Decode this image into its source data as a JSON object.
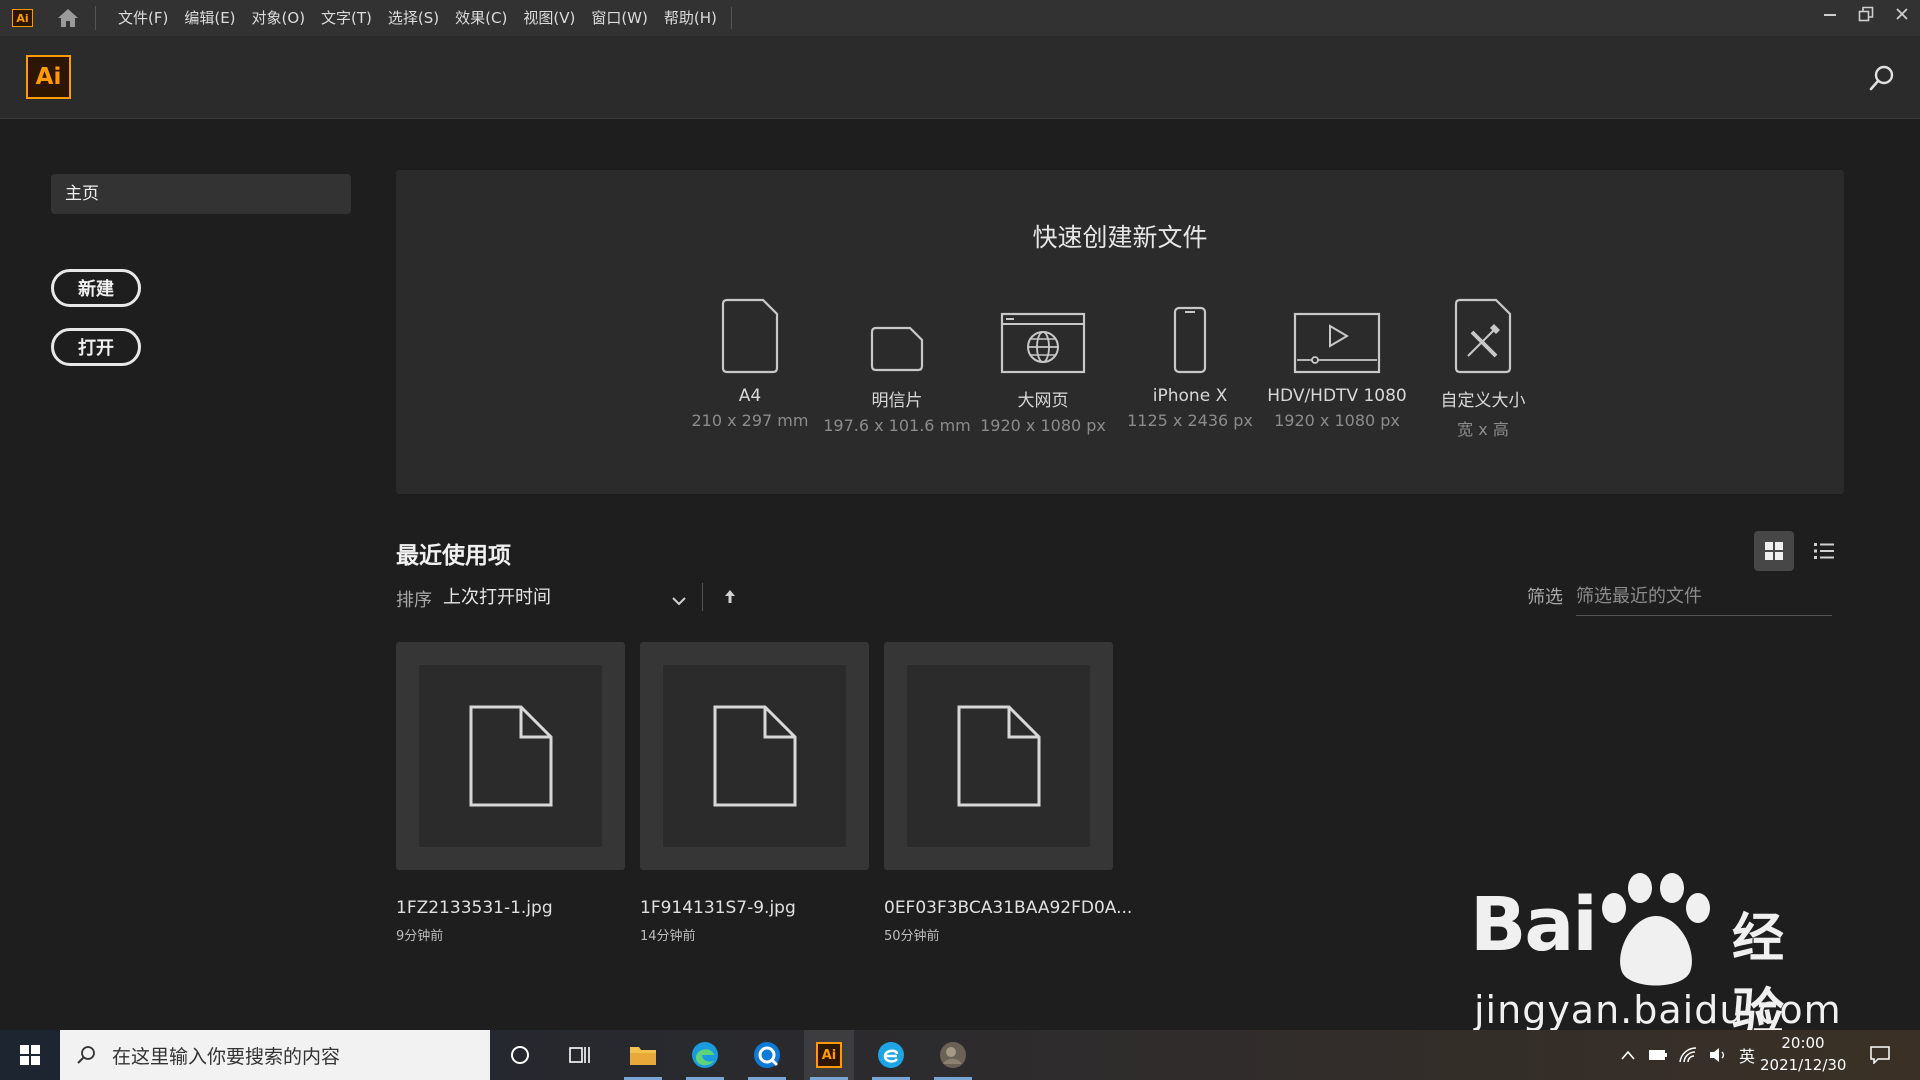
{
  "menubar": {
    "app_badge": "Ai",
    "items": [
      "文件(F)",
      "编辑(E)",
      "对象(O)",
      "文字(T)",
      "选择(S)",
      "效果(C)",
      "视图(V)",
      "窗口(W)",
      "帮助(H)"
    ]
  },
  "header": {
    "logo": "Ai"
  },
  "sidebar": {
    "home": "主页",
    "new_button": "新建",
    "open_button": "打开"
  },
  "quick_create": {
    "title": "快速创建新文件",
    "presets": [
      {
        "name": "A4",
        "dims": "210 x 297 mm",
        "icon": "page-icon"
      },
      {
        "name": "明信片",
        "dims": "197.6 x 101.6 mm",
        "icon": "postcard-icon"
      },
      {
        "name": "大网页",
        "dims": "1920 x 1080 px",
        "icon": "web-icon"
      },
      {
        "name": "iPhone X",
        "dims": "1125 x 2436 px",
        "icon": "phone-icon"
      },
      {
        "name": "HDV/HDTV 1080",
        "dims": "1920 x 1080 px",
        "icon": "video-icon"
      },
      {
        "name": "自定义大小",
        "dims": "宽 x 高",
        "icon": "custom-size-icon"
      }
    ]
  },
  "recent": {
    "title": "最近使用项",
    "sort_label": "排序",
    "sort_value": "上次打开时间",
    "filter_label": "筛选",
    "filter_placeholder": "筛选最近的文件",
    "files": [
      {
        "name": "1FZ2133531-1.jpg",
        "time": "9分钟前"
      },
      {
        "name": "1F914131S7-9.jpg",
        "time": "14分钟前"
      },
      {
        "name": "0EF03F3BCA31BAA92FD0A...",
        "time": "50分钟前"
      }
    ]
  },
  "taskbar": {
    "search_placeholder": "在这里输入你要搜索的内容",
    "ai_label": "Ai",
    "ime": "英",
    "time": "20:00",
    "date": "2021/12/30"
  },
  "watermark": {
    "brand": "Bai",
    "brand2": "经验",
    "url": "jingyan.baidu.com"
  },
  "colors": {
    "accent": "#ff9a00",
    "background": "#1e1e1e",
    "panel": "#2b2b2b"
  }
}
